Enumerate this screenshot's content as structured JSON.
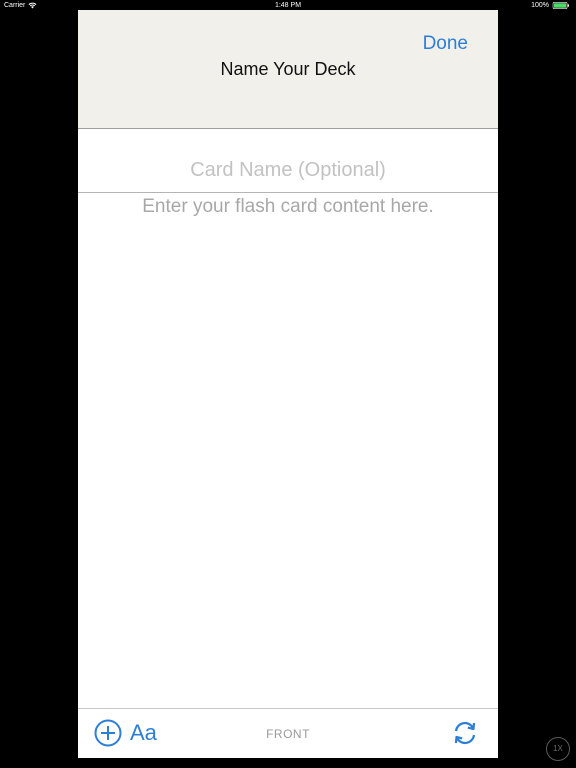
{
  "status_bar": {
    "carrier": "Carrier",
    "time": "1:48 PM",
    "battery_percent": "100%",
    "battery_level": 1.0,
    "wifi_icon": "wifi-icon",
    "battery_icon": "battery-icon"
  },
  "header": {
    "title": "Name Your Deck",
    "done_label": "Done"
  },
  "card": {
    "name_placeholder": "Card Name (Optional)",
    "name_value": "",
    "content_placeholder": "Enter your flash card content here.",
    "content_value": ""
  },
  "toolbar": {
    "add_icon": "plus-circle-icon",
    "font_label": "Aa",
    "side_label": "FRONT",
    "flip_icon": "flip-card-icon"
  },
  "zoom": {
    "label": "1X"
  },
  "colors": {
    "accent": "#2d7fd6",
    "header_background": "#f1f0eb",
    "battery_fill": "#4cd964"
  }
}
